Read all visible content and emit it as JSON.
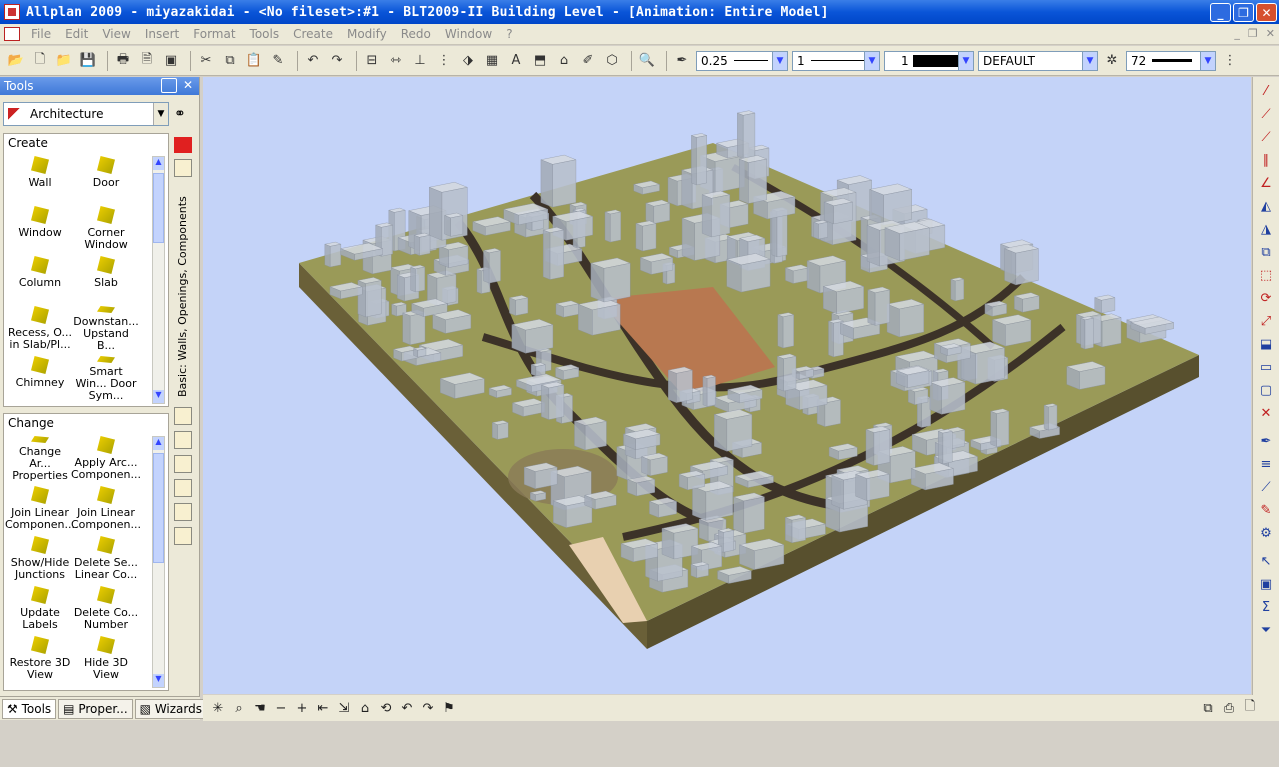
{
  "window": {
    "title": "Allplan 2009 - miyazakidai - <No fileset>:#1 - BLT2009-II Building Level - [Animation: Entire Model]",
    "buttons": [
      "_",
      "❐",
      "✕"
    ]
  },
  "menu": {
    "items": [
      "File",
      "Edit",
      "View",
      "Insert",
      "Format",
      "Tools",
      "Create",
      "Modify",
      "Redo",
      "Window",
      "?"
    ]
  },
  "toolbar": {
    "pen_thickness": "0.25",
    "line_type": "1",
    "color_number": "1",
    "layer": "DEFAULT",
    "line_style": "72"
  },
  "tools_panel": {
    "title": "Tools",
    "palette": "Architecture",
    "vertical_tab": "Basic: Walls, Openings, Components",
    "create": {
      "heading": "Create",
      "items": [
        "Wall",
        "Door",
        "Window",
        "Corner Window",
        "Column",
        "Slab",
        "Recess, O... in Slab/Pl...",
        "Downstan... Upstand B...",
        "Chimney",
        "Smart Win... Door Sym..."
      ]
    },
    "change": {
      "heading": "Change",
      "items": [
        "Change Ar... Properties",
        "Apply Arc... Componen...",
        "Join Linear Componen...",
        "Join Linear Componen...",
        "Show/Hide Junctions",
        "Delete Se... Linear Co...",
        "Update Labels",
        "Delete Co... Number",
        "Restore 3D View",
        "Hide 3D View"
      ]
    }
  },
  "bottom_tabs": [
    "Tools",
    "Proper...",
    "Wizards"
  ],
  "colors": {
    "sky": "#c4d3f8",
    "terrain": "#9a9a58",
    "road": "#3c3228",
    "site": "#b87850",
    "building": "#b8c0cc",
    "base": "#6a6038"
  }
}
